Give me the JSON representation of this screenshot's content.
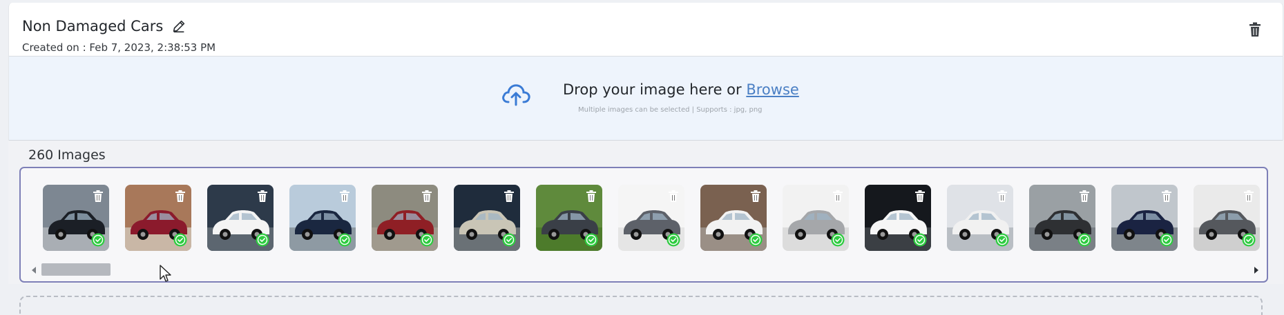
{
  "header": {
    "title": "Non Damaged Cars",
    "created": "Created on : Feb 7, 2023, 2:38:53 PM"
  },
  "upload": {
    "drop_text": "Drop your image here or",
    "browse_label": "Browse",
    "supports_text": "Multiple images can be selected | Supports : jpg, png"
  },
  "gallery": {
    "count_label": "260 Images",
    "thumbnails": [
      {
        "bg": "#7d8792",
        "car": "#1b1f26",
        "ground": "#a9aeb4"
      },
      {
        "bg": "#a8785a",
        "car": "#8b1a2c",
        "ground": "#c9b7a6"
      },
      {
        "bg": "#2d3a4a",
        "car": "#f4f4f4",
        "ground": "#5c6670"
      },
      {
        "bg": "#b9cbdb",
        "car": "#1a2740",
        "ground": "#8e9aa3"
      },
      {
        "bg": "#8d8b7f",
        "car": "#8f1f25",
        "ground": "#a09a8e"
      },
      {
        "bg": "#1f2c3c",
        "car": "#c9c5b6",
        "ground": "#6a7176"
      },
      {
        "bg": "#5f8a3c",
        "car": "#3a3f47",
        "ground": "#4d7b2b"
      },
      {
        "bg": "#f5f5f5",
        "car": "#5d6169",
        "ground": "#e5e5e5"
      },
      {
        "bg": "#7a6150",
        "car": "#f2f2f2",
        "ground": "#9a8f86"
      },
      {
        "bg": "#f2f2f2",
        "car": "#a5a7aa",
        "ground": "#dcdcdc"
      },
      {
        "bg": "#15181d",
        "car": "#f6f6f6",
        "ground": "#3b3f44"
      },
      {
        "bg": "#dfe2e7",
        "car": "#f1f1f1",
        "ground": "#b9bec4"
      },
      {
        "bg": "#9aa0a4",
        "car": "#2e3033",
        "ground": "#7a8086"
      },
      {
        "bg": "#c0c6cc",
        "car": "#1a2342",
        "ground": "#7e858b"
      },
      {
        "bg": "#eaeaea",
        "car": "#55585d",
        "ground": "#cfcfcf"
      }
    ]
  },
  "colors": {
    "accent": "#4a7fc4",
    "success": "#2ecc40",
    "gallery_border": "#7d7fb7"
  },
  "icons": {
    "edit": "pencil-icon",
    "delete": "trash-icon",
    "upload": "cloud-upload-icon",
    "status": "check-circle-icon"
  }
}
